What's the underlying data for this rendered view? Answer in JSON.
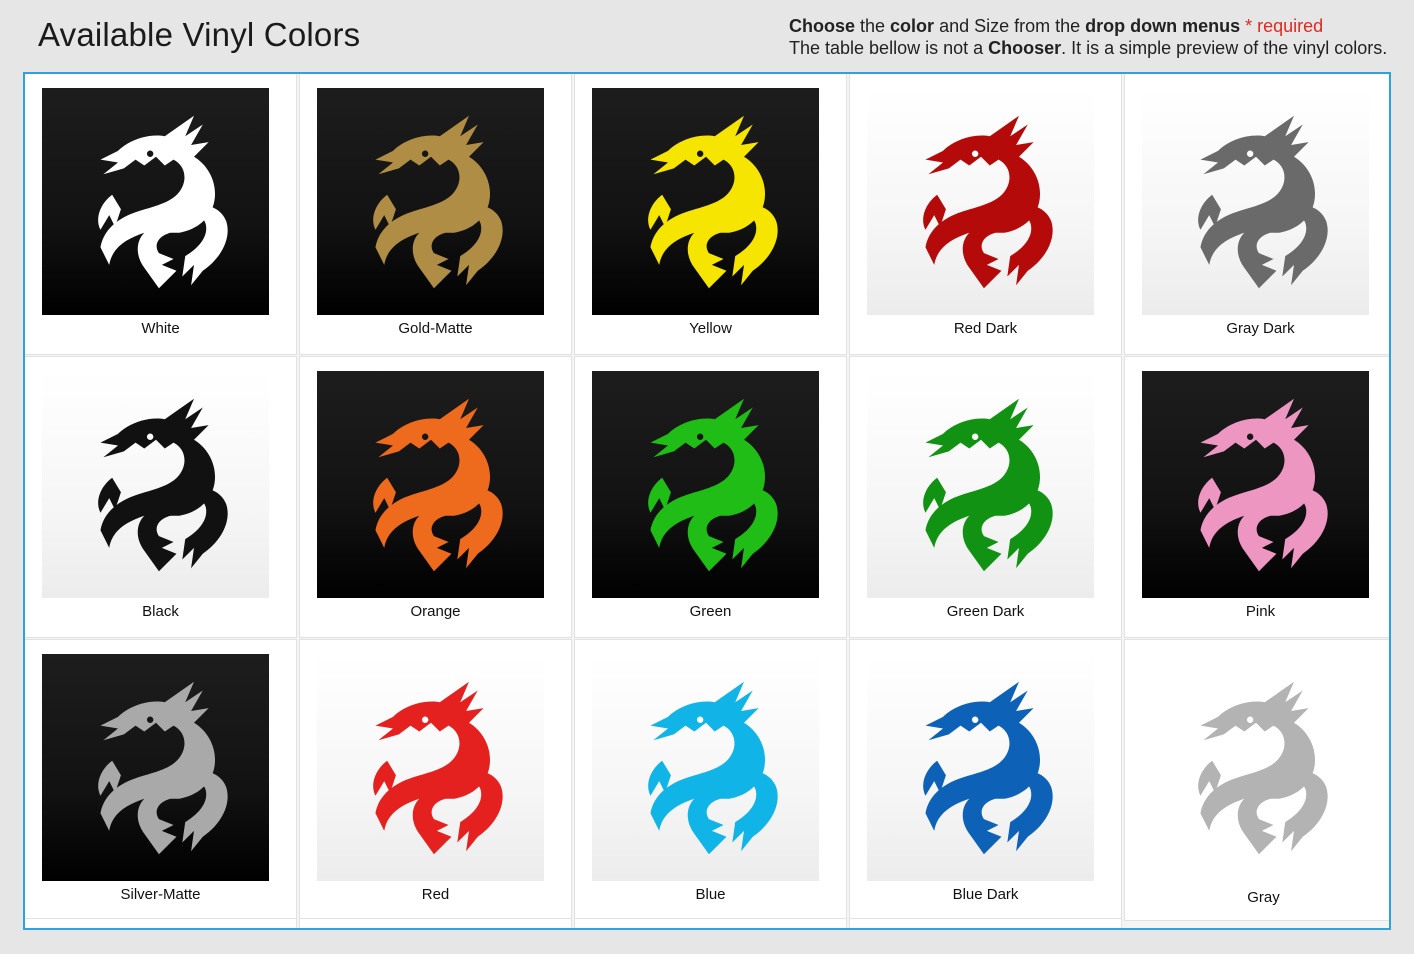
{
  "header": {
    "title": "Available Vinyl Colors",
    "line1": {
      "w1": "Choose",
      "w2": " the ",
      "w3": "color",
      "w4": " and Size from the ",
      "w5": "drop down menus",
      "w6": " * required"
    },
    "line2": {
      "w1": "The table bellow is not a ",
      "w2": "Chooser",
      "w3": ". It is a simple preview of the vinyl colors."
    }
  },
  "colors": [
    {
      "name": "White",
      "fill": "#ffffff",
      "bg": "dark",
      "icon": "dragon-icon"
    },
    {
      "name": "Gold-Matte",
      "fill": "#b08d45",
      "bg": "dark",
      "icon": "dragon-icon"
    },
    {
      "name": "Yellow",
      "fill": "#f5e500",
      "bg": "dark",
      "icon": "dragon-icon"
    },
    {
      "name": "Red Dark",
      "fill": "#b40a0a",
      "bg": "light",
      "icon": "dragon-icon"
    },
    {
      "name": "Gray Dark",
      "fill": "#6a6a6a",
      "bg": "light",
      "icon": "dragon-icon"
    },
    {
      "name": "Black",
      "fill": "#111111",
      "bg": "light",
      "icon": "dragon-icon"
    },
    {
      "name": "Orange",
      "fill": "#ee6a1c",
      "bg": "dark",
      "icon": "dragon-icon"
    },
    {
      "name": "Green",
      "fill": "#1fbd16",
      "bg": "dark",
      "icon": "dragon-icon"
    },
    {
      "name": "Green Dark",
      "fill": "#129212",
      "bg": "light",
      "icon": "dragon-icon"
    },
    {
      "name": "Pink",
      "fill": "#ee96c2",
      "bg": "dark",
      "icon": "dragon-icon"
    },
    {
      "name": "Silver-Matte",
      "fill": "#a9a9a9",
      "bg": "dark",
      "icon": "dragon-icon"
    },
    {
      "name": "Red",
      "fill": "#e4211f",
      "bg": "light",
      "icon": "dragon-icon"
    },
    {
      "name": "Blue",
      "fill": "#10b4e6",
      "bg": "light",
      "icon": "dragon-icon"
    },
    {
      "name": "Blue Dark",
      "fill": "#0d62b8",
      "bg": "light",
      "icon": "dragon-icon"
    },
    {
      "name": "Gray",
      "fill": "#b3b3b3",
      "bg": "none",
      "icon": "dragon-icon"
    }
  ],
  "theme": {
    "frame_border": "#2ba3de",
    "required": "#e0281e"
  }
}
